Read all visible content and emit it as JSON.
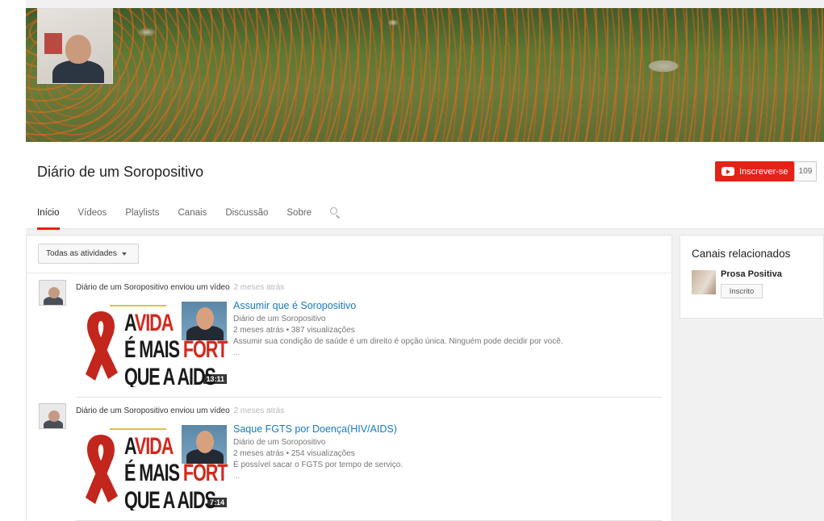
{
  "channel": {
    "name": "Diário de um Soropositivo",
    "subscribe_label": "Inscrever-se",
    "subscriber_count": "109"
  },
  "tabs": [
    {
      "label": "Início",
      "active": true
    },
    {
      "label": "Vídeos"
    },
    {
      "label": "Playlists"
    },
    {
      "label": "Canais"
    },
    {
      "label": "Discussão"
    },
    {
      "label": "Sobre"
    }
  ],
  "feed": {
    "filter_label": "Todas as atividades",
    "items": [
      {
        "author": "Diário de um Soropositivo",
        "action": "enviou um vídeo",
        "ago": "2 meses atrás",
        "title": "Assumir que é Soropositivo",
        "channel": "Diário de um Soropositivo",
        "meta": "2 meses atrás • 387 visualizações",
        "description": "Assumir sua condição de saúde é um direito é opção única. Ninguém pode decidir por você.",
        "more": "...",
        "duration": "13:11"
      },
      {
        "author": "Diário de um Soropositivo",
        "action": "enviou um vídeo",
        "ago": "2 meses atrás",
        "title": "Saque FGTS por Doença(HIV/AIDS)",
        "channel": "Diário de um Soropositivo",
        "meta": "2 meses atrás • 254 visualizações",
        "description": "É possível sacar o FGTS por tempo de serviço.",
        "more": "...",
        "duration": "7:14"
      }
    ],
    "thumbnail_text": {
      "line1_a": "A",
      "line1_b": "VIDA",
      "line2_a": "É MAIS ",
      "line2_b": "FORTE",
      "line3": "QUE A AIDS"
    }
  },
  "related": {
    "heading": "Canais relacionados",
    "channel_name": "Prosa Positiva",
    "button_label": "Inscrito"
  },
  "colors": {
    "accent": "#e62117",
    "link": "#167ac6"
  }
}
